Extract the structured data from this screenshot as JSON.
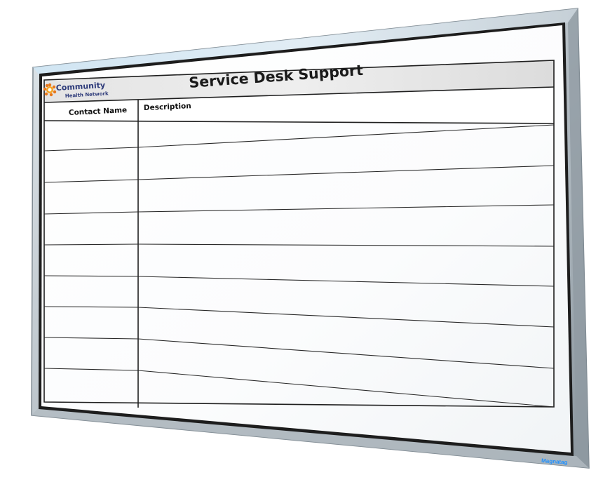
{
  "board": {
    "title": "Service Desk Support",
    "logo": {
      "line1": "Community",
      "line2": "Health Network"
    },
    "columns": [
      "Contact Name",
      "Description"
    ],
    "row_count": 9,
    "brand_badge": "Magnatag",
    "colors": {
      "frame": "#a9b4bc",
      "frame_highlight": "#e8eef2",
      "frame_shadow": "#7e8a93",
      "surface": "#ffffff",
      "header_band": "#e6e6e6",
      "grid_line": "#2a2a2a",
      "logo_orange": "#f08a1c",
      "logo_blue": "#2e3b7a",
      "badge_blue": "#1e90ff"
    }
  }
}
